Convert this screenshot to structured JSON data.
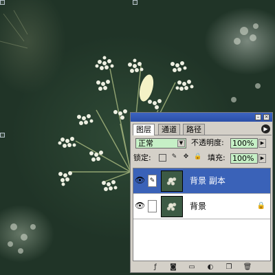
{
  "canvas": {
    "description_icon": "photo-canvas"
  },
  "panel": {
    "tabs": [
      {
        "label": "图层",
        "active": true
      },
      {
        "label": "通道",
        "active": false
      },
      {
        "label": "路径",
        "active": false
      }
    ],
    "blend_mode": "正常",
    "opacity_label": "不透明度:",
    "opacity_value": "100%",
    "lock_label": "锁定:",
    "fill_label": "填充:",
    "fill_value": "100%",
    "layers": [
      {
        "name": "背景 副本",
        "selected": true,
        "locked": false
      },
      {
        "name": "背景",
        "selected": false,
        "locked": true
      }
    ],
    "colors": {
      "titlebar": "#2b4fa8",
      "selection": "#3a62b8",
      "field_bg": "#c6f0c6",
      "panel_bg": "#d4d0c8"
    }
  }
}
